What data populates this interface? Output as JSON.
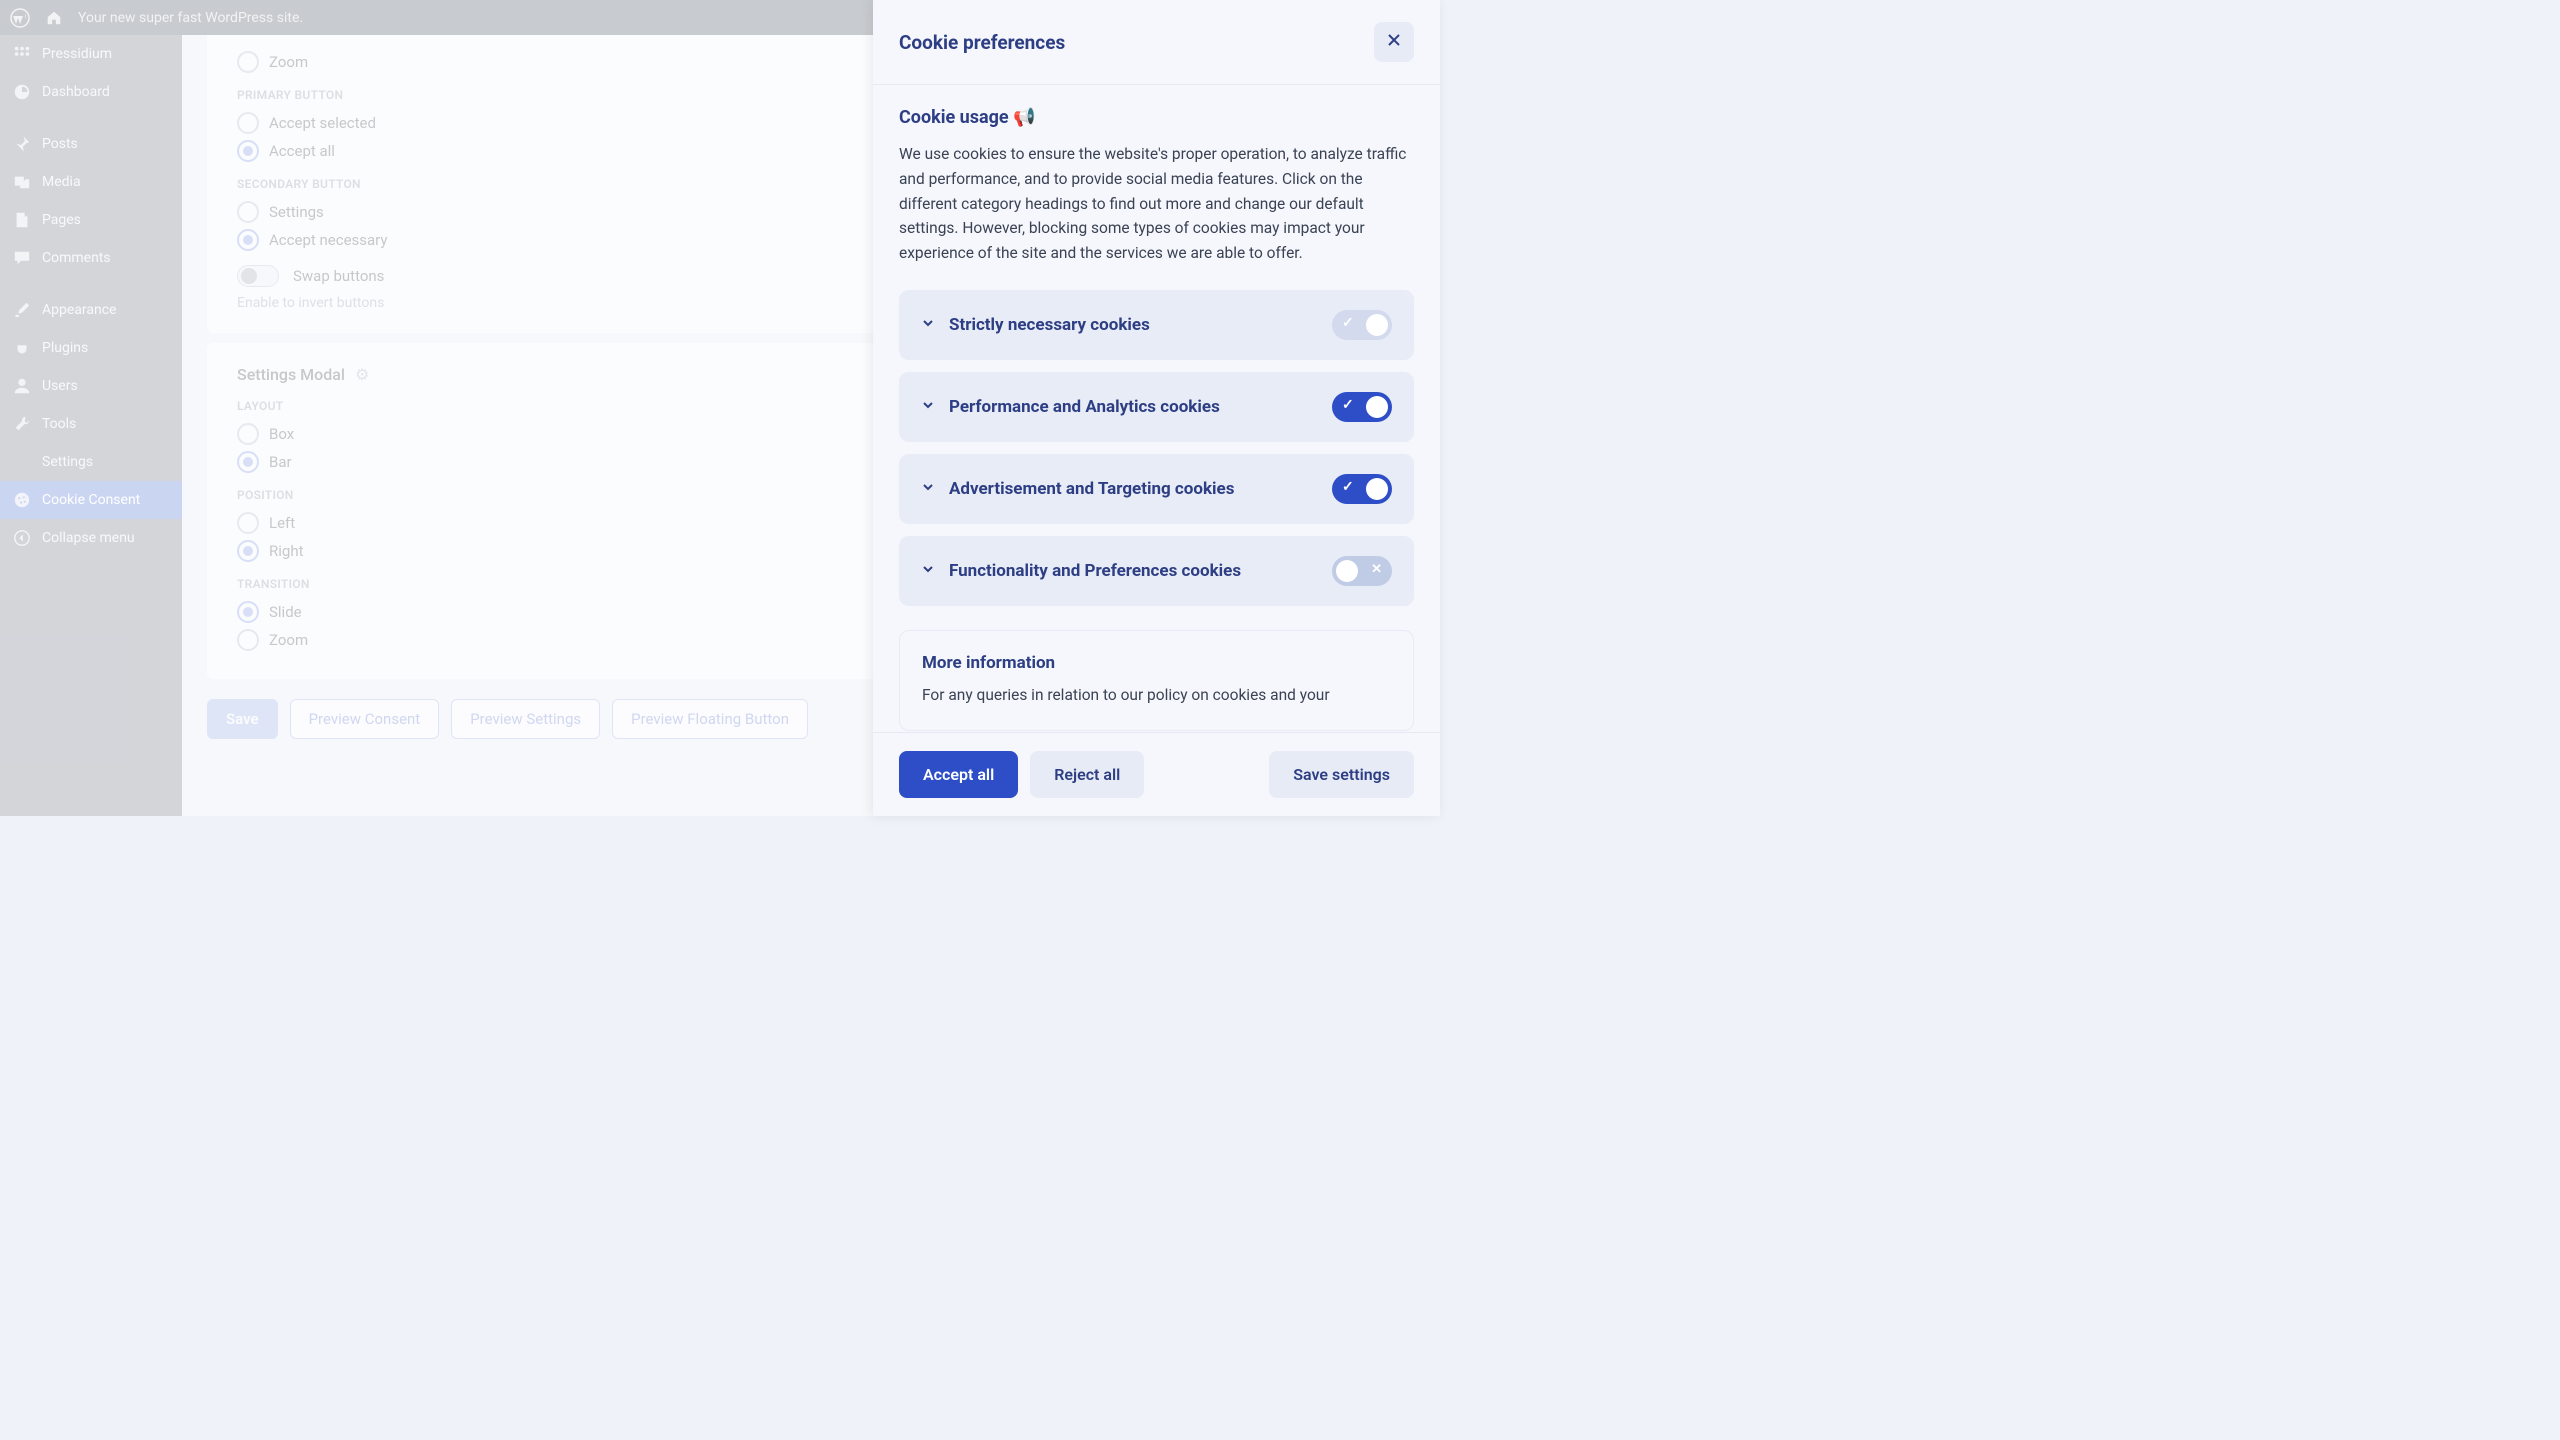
{
  "adminbar": {
    "site_title": "Your new super fast WordPress site."
  },
  "sidebar": {
    "items": [
      {
        "label": "Pressidium"
      },
      {
        "label": "Dashboard"
      },
      {
        "label": "Posts"
      },
      {
        "label": "Media"
      },
      {
        "label": "Pages"
      },
      {
        "label": "Comments"
      },
      {
        "label": "Appearance"
      },
      {
        "label": "Plugins"
      },
      {
        "label": "Users"
      },
      {
        "label": "Tools"
      },
      {
        "label": "Settings"
      },
      {
        "label": "Cookie Consent"
      },
      {
        "label": "Collapse menu"
      }
    ]
  },
  "settings": {
    "zoom": "Zoom",
    "primary_button_label": "PRIMARY BUTTON",
    "primary_opts": {
      "accept_selected": "Accept selected",
      "accept_all": "Accept all"
    },
    "secondary_button_label": "SECONDARY BUTTON",
    "secondary_opts": {
      "settings": "Settings",
      "accept_necessary": "Accept necessary"
    },
    "swap_buttons": "Swap buttons",
    "swap_hint": "Enable to invert buttons",
    "settings_modal": "Settings Modal",
    "layout_label": "LAYOUT",
    "layout": {
      "box": "Box",
      "bar": "Bar"
    },
    "position_label": "POSITION",
    "position": {
      "left": "Left",
      "right": "Right"
    },
    "transition_label": "TRANSITION",
    "transition": {
      "slide": "Slide",
      "zoom": "Zoom"
    },
    "footer": {
      "save": "Save",
      "preview_consent": "Preview Consent",
      "preview_settings": "Preview Settings",
      "preview_floating": "Preview Floating Button"
    }
  },
  "cookie_panel": {
    "title": "Cookie preferences",
    "usage_title": "Cookie usage 📢",
    "usage_text": "We use cookies to ensure the website's proper operation, to analyze traffic and performance, and to provide social media features. Click on the different category headings to find out more and change our default settings. However, blocking some types of cookies may impact your experience of the site and the services we are able to offer.",
    "categories": [
      {
        "label": "Strictly necessary cookies",
        "state": "locked"
      },
      {
        "label": "Performance and Analytics cookies",
        "state": "on"
      },
      {
        "label": "Advertisement and Targeting cookies",
        "state": "on"
      },
      {
        "label": "Functionality and Preferences cookies",
        "state": "off"
      }
    ],
    "more_info_title": "More information",
    "more_info_text": "For any queries in relation to our policy on cookies and your",
    "footer": {
      "accept_all": "Accept all",
      "reject_all": "Reject all",
      "save": "Save settings"
    }
  }
}
